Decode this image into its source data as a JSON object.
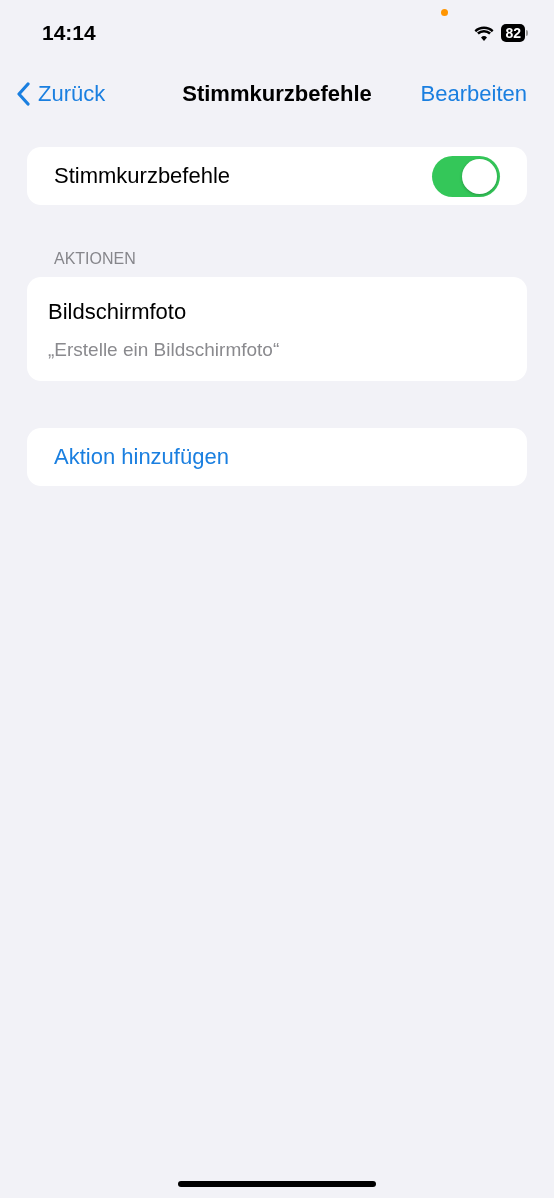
{
  "status_bar": {
    "time": "14:14",
    "battery": "82"
  },
  "nav": {
    "back": "Zurück",
    "title": "Stimmkurzbefehle",
    "action": "Bearbeiten"
  },
  "toggle_row": {
    "label": "Stimmkurzbefehle",
    "on": true
  },
  "section": {
    "header": "AKTIONEN",
    "items": [
      {
        "title": "Bildschirmfoto",
        "subtitle": "„Erstelle ein Bildschirmfoto“"
      }
    ]
  },
  "add_action": {
    "label": "Aktion hinzufügen"
  }
}
